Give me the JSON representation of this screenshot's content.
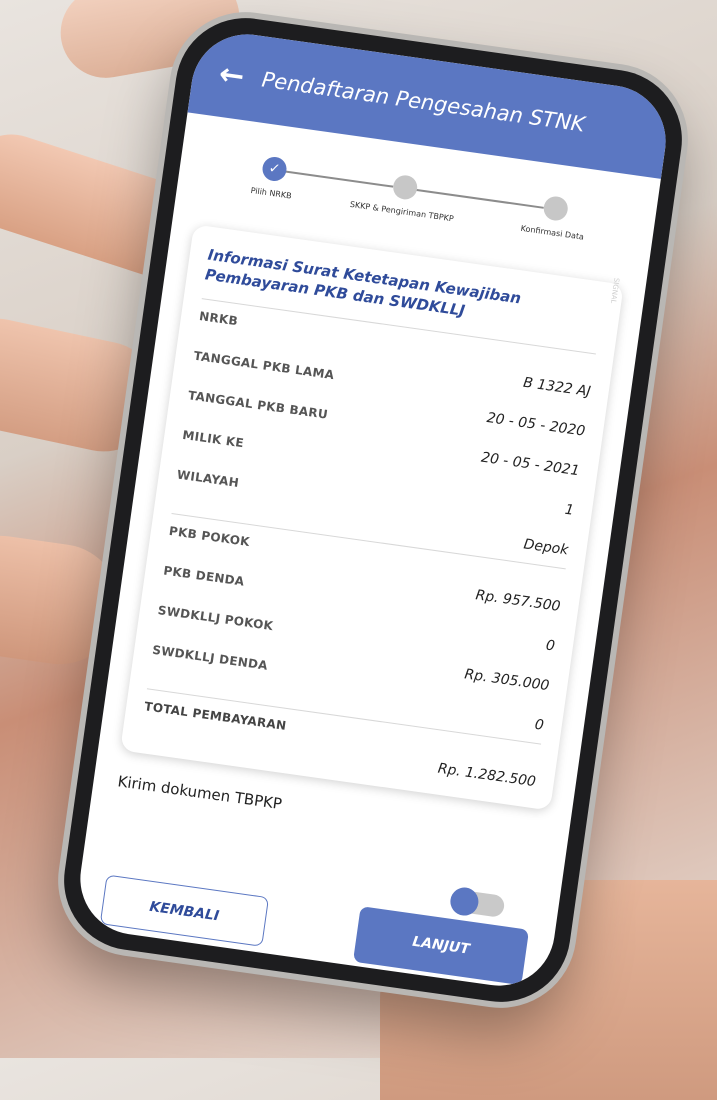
{
  "header": {
    "title": "Pendaftaran Pengesahan STNK",
    "back_icon": "back-arrow-icon"
  },
  "stepper": {
    "steps": [
      {
        "label": "Pilih NRKB",
        "done": true
      },
      {
        "label": "SKKP & Pengiriman TBPKP",
        "done": false
      },
      {
        "label": "Konfirmasi Data",
        "done": false
      }
    ]
  },
  "card": {
    "title": "Informasi Surat Ketetapan Kewajiban Pembayaran PKB dan SWDKLLJ",
    "watermark": "SIGNAL",
    "vehicle_rows": [
      {
        "label": "NRKB",
        "value": "B 1322 AJ"
      },
      {
        "label": "TANGGAL PKB LAMA",
        "value": "20 - 05 - 2020"
      },
      {
        "label": "TANGGAL PKB BARU",
        "value": "20 - 05 - 2021"
      },
      {
        "label": "MILIK KE",
        "value": "1"
      },
      {
        "label": "WILAYAH",
        "value": "Depok"
      }
    ],
    "payment_rows": [
      {
        "label": "PKB POKOK",
        "value": "Rp. 957.500"
      },
      {
        "label": "PKB DENDA",
        "value": "0"
      },
      {
        "label": "SWDKLLJ POKOK",
        "value": "Rp. 305.000"
      },
      {
        "label": "SWDKLLJ DENDA",
        "value": "0"
      }
    ],
    "total": {
      "label": "TOTAL PEMBAYARAN",
      "value": "Rp. 1.282.500"
    }
  },
  "kirim": {
    "label": "Kirim dokumen TBPKP",
    "toggle_on": true
  },
  "buttons": {
    "back": "KEMBALI",
    "next": "LANJUT"
  },
  "colors": {
    "primary": "#5b77c2",
    "title": "#2f4b9a"
  }
}
